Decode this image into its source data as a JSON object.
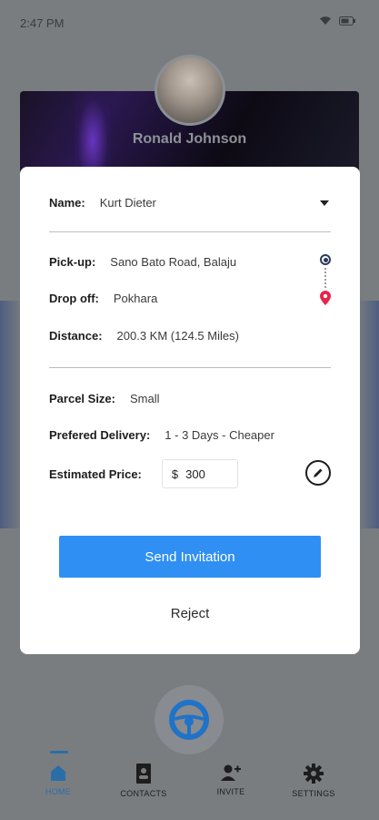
{
  "status": {
    "time": "2:47 PM"
  },
  "profile": {
    "name": "Ronald Johnson"
  },
  "form": {
    "name_label": "Name:",
    "name_value": "Kurt Dieter",
    "pickup_label": "Pick-up:",
    "pickup_value": "Sano Bato Road, Balaju",
    "dropoff_label": "Drop off:",
    "dropoff_value": "Pokhara",
    "distance_label": "Distance:",
    "distance_value": "200.3 KM (124.5 Miles)",
    "parcel_label": "Parcel Size:",
    "parcel_value": "Small",
    "delivery_label": "Prefered Delivery:",
    "delivery_value": "1 - 3 Days - Cheaper",
    "price_label": "Estimated Price:",
    "price_currency": "$",
    "price_value": "300"
  },
  "actions": {
    "send": "Send Invitation",
    "reject": "Reject"
  },
  "nav": [
    {
      "label": "HOME",
      "active": true
    },
    {
      "label": "CONTACTS",
      "active": false
    },
    {
      "label": "INVITE",
      "active": false
    },
    {
      "label": "SETTINGS",
      "active": false
    }
  ],
  "colors": {
    "accent": "#2f8ff2",
    "pin": "#e8234a",
    "nav_active": "#2a6ea8"
  }
}
